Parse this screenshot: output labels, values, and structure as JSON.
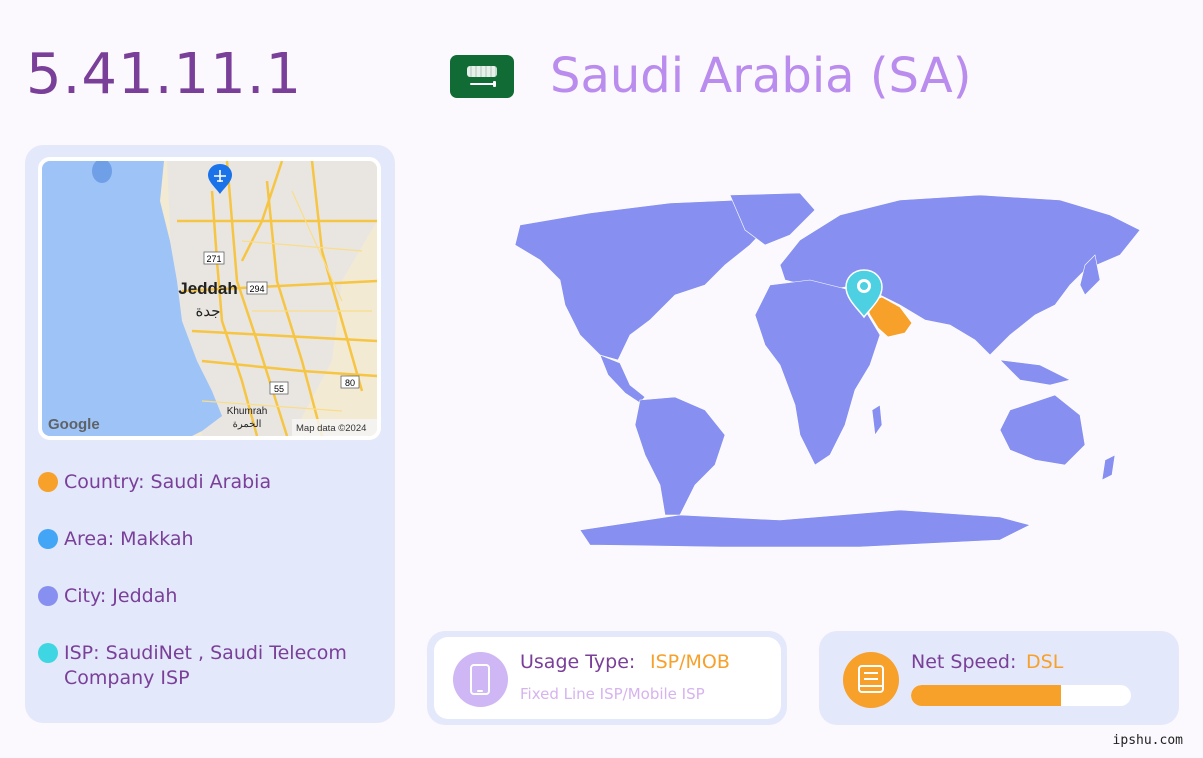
{
  "header": {
    "ip": "5.41.11.1",
    "country_title": "Saudi Arabia (SA)",
    "flag_icon": "saudi-arabia-flag"
  },
  "mini_map": {
    "city_label": "Jeddah",
    "city_label_ar": "جدة",
    "district_label": "Khumrah",
    "district_label_ar": "الخمرة",
    "road_labels": [
      "271",
      "294",
      "55",
      "80"
    ],
    "google_label": "Google",
    "attribution": "Map data ©2024",
    "airport_icon": "airport-pin-icon",
    "colors": {
      "sea": "#9ec3f6",
      "land": "#f3ead4",
      "road": "#f6c543"
    }
  },
  "info": [
    {
      "label": "Country: Saudi Arabia",
      "color": "#f7a02a"
    },
    {
      "label": "Area: Makkah",
      "color": "#42a5f5"
    },
    {
      "label": "City: Jeddah",
      "color": "#8790f0"
    },
    {
      "label": "ISP: SaudiNet , Saudi Telecom Company ISP",
      "color": "#3dd6e2"
    }
  ],
  "world_map": {
    "land_color": "#8790f0",
    "highlight_color": "#f7a02a",
    "pin_color": "#4dd0e1",
    "pin_icon": "location-pin-icon"
  },
  "usage": {
    "label": "Usage Type:",
    "value": "ISP/MOB",
    "sub": "Fixed Line ISP/Mobile ISP",
    "icon": "phone-icon"
  },
  "speed": {
    "label": "Net Speed:",
    "value": "DSL",
    "level": 0.68,
    "icon": "network-speed-icon"
  },
  "footer": {
    "site": "ipshu.com"
  }
}
